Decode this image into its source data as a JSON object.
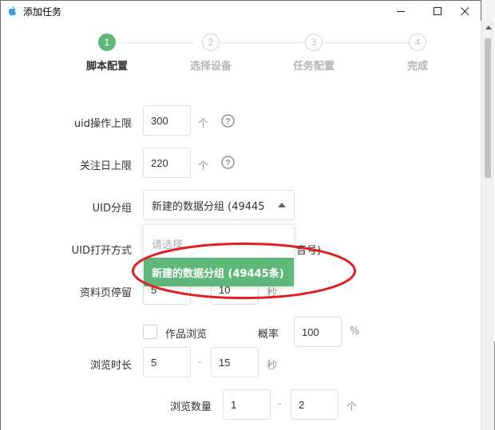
{
  "window": {
    "title": "添加任务"
  },
  "steps": [
    {
      "number": "1",
      "label": "脚本配置",
      "active": true
    },
    {
      "number": "2",
      "label": "选择设备",
      "active": false
    },
    {
      "number": "3",
      "label": "任务配置",
      "active": false
    },
    {
      "number": "4",
      "label": "完成",
      "active": false
    }
  ],
  "form": {
    "uid_limit": {
      "label": "uid操作上限",
      "value": "300",
      "unit": "个"
    },
    "follow_limit": {
      "label": "关注日上限",
      "value": "220",
      "unit": "个"
    },
    "uid_group": {
      "label": "UID分组",
      "selected": "新建的数据分组 (49445",
      "options_placeholder": "请选择",
      "highlighted_option": "新建的数据分组 (49445条)"
    },
    "uid_open_mode": {
      "label": "UID打开方式",
      "partial_text": "音号)"
    },
    "profile_stay": {
      "label": "资料页停留",
      "min": "5",
      "max": "10",
      "unit": "秒"
    },
    "work_browse": {
      "label": "作品浏览",
      "prob_label": "概率",
      "prob_value": "100",
      "prob_unit": "%"
    },
    "browse_duration": {
      "label": "浏览时长",
      "min": "5",
      "max": "15",
      "unit": "秒",
      "sep": "-"
    },
    "browse_count": {
      "label": "浏览数量",
      "min": "1",
      "max": "2",
      "unit": "个",
      "sep": "-"
    }
  },
  "colors": {
    "accent": "#5fb87a",
    "annotation": "#e02020"
  }
}
